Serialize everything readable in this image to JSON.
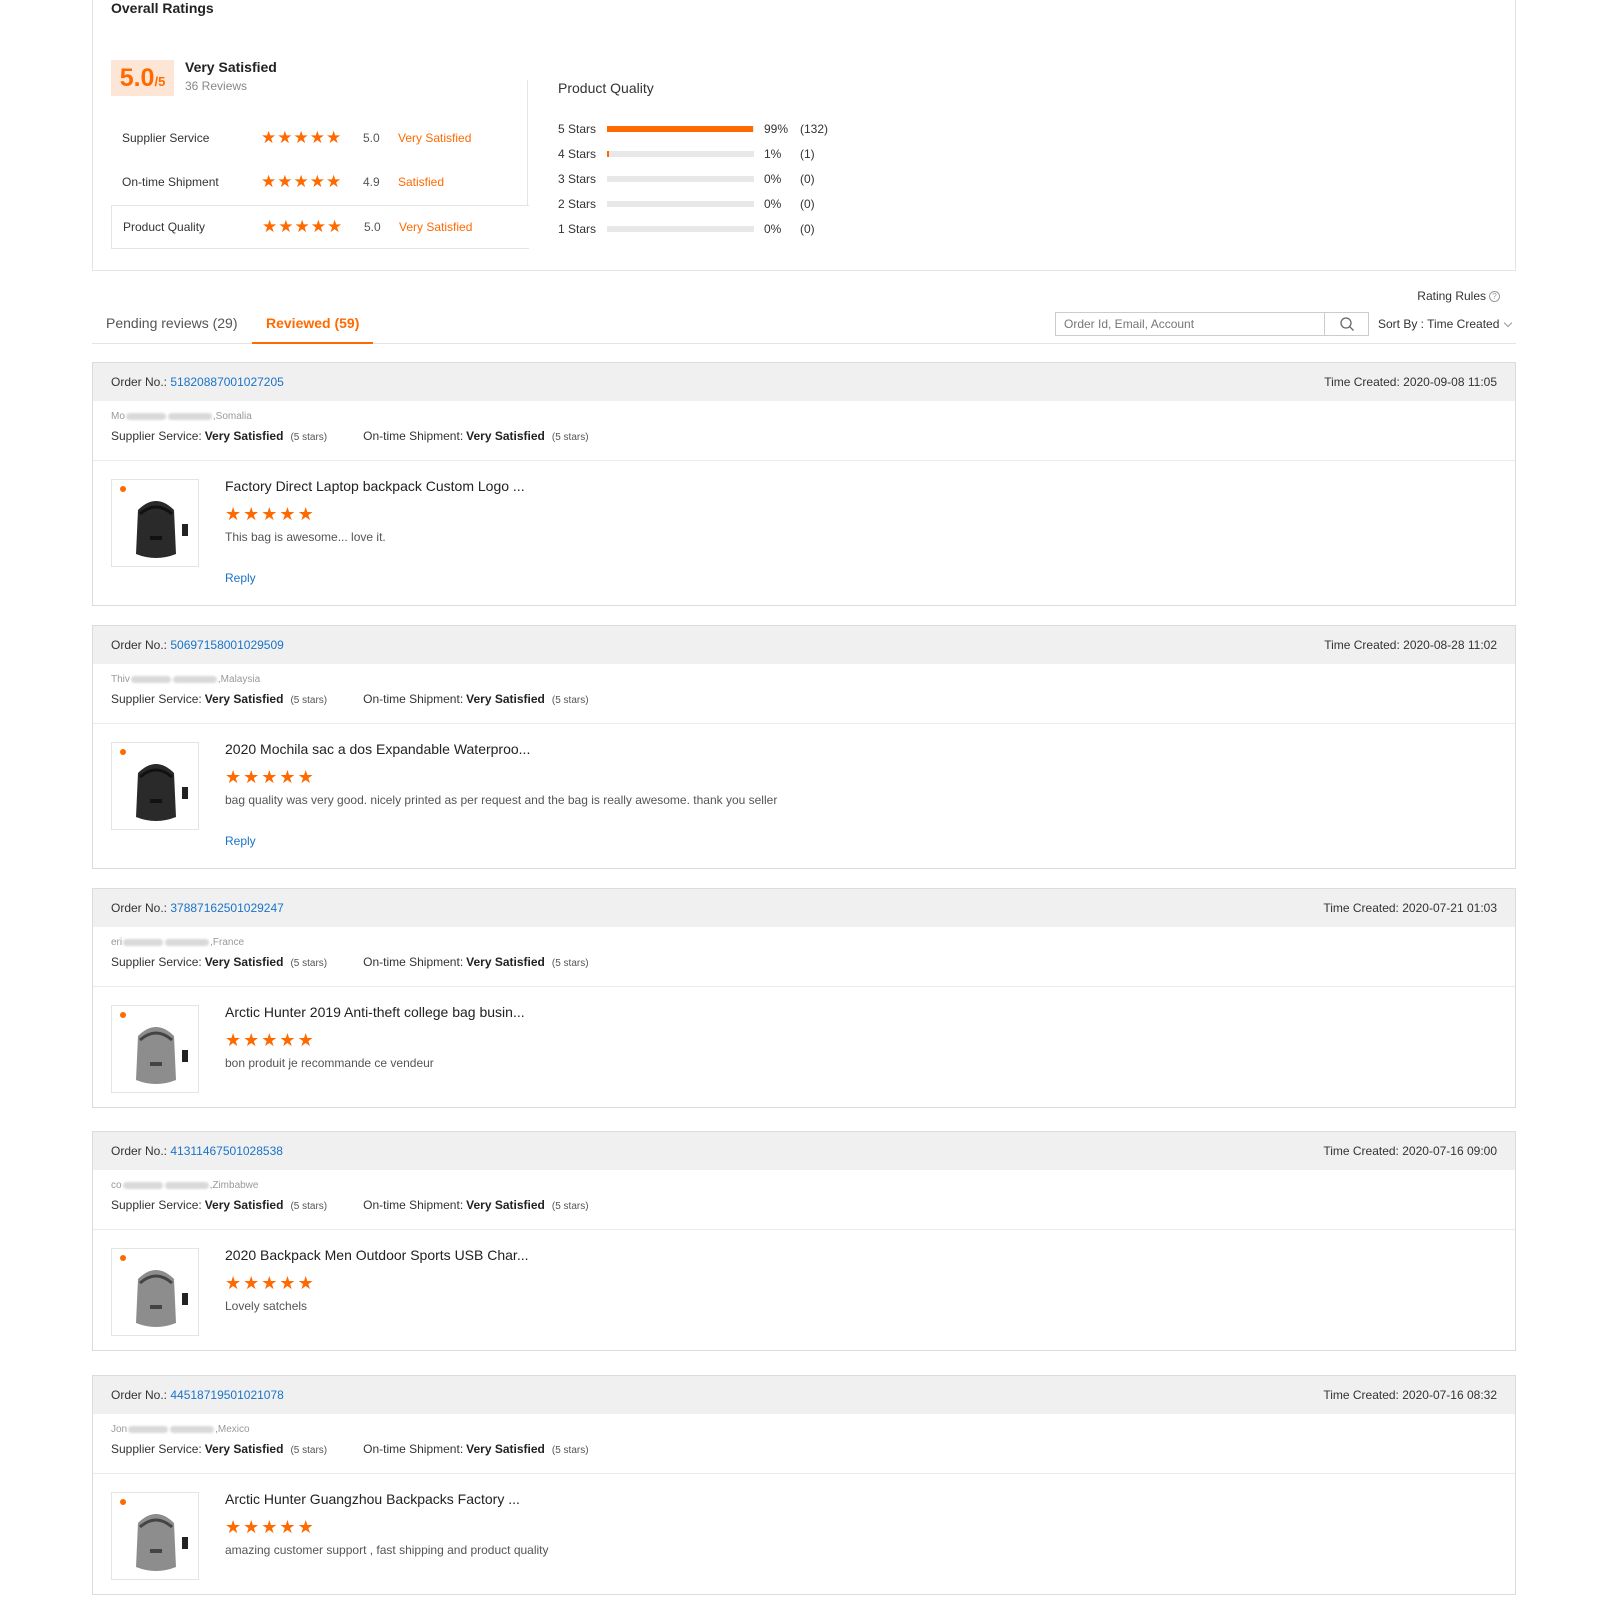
{
  "overall": {
    "title": "Overall Ratings",
    "score": "5.0",
    "score_suffix": "/5",
    "score_label": "Very Satisfied",
    "review_count": "36 Reviews",
    "metrics": [
      {
        "name": "Supplier Service",
        "stars": 5,
        "value": "5.0",
        "label": "Very Satisfied"
      },
      {
        "name": "On-time Shipment",
        "stars": 5,
        "value": "4.9",
        "label": "Satisfied"
      },
      {
        "name": "Product Quality",
        "stars": 5,
        "value": "5.0",
        "label": "Very Satisfied"
      }
    ],
    "distribution_title": "Product Quality",
    "distribution": [
      {
        "label": "5 Stars",
        "fraction": 0.99,
        "pct": "99%",
        "count": "(132)"
      },
      {
        "label": "4 Stars",
        "fraction": 0.01,
        "pct": "1%",
        "count": "(1)"
      },
      {
        "label": "3 Stars",
        "fraction": 0,
        "pct": "0%",
        "count": "(0)"
      },
      {
        "label": "2 Stars",
        "fraction": 0,
        "pct": "0%",
        "count": "(0)"
      },
      {
        "label": "1 Stars",
        "fraction": 0,
        "pct": "0%",
        "count": "(0)"
      }
    ]
  },
  "toolbar": {
    "rating_rules": "Rating Rules",
    "tab_pending": "Pending reviews (29)",
    "tab_reviewed": "Reviewed (59)",
    "search_placeholder": "Order Id, Email, Account",
    "sort_label": "Sort By : Time Created"
  },
  "labels": {
    "order_no": "Order No.:",
    "time_created": "Time Created:",
    "supplier_service": "Supplier Service:",
    "ontime_shipment": "On-time Shipment:",
    "reply": "Reply"
  },
  "reviews": [
    {
      "order_no": "51820887001027205",
      "time": "2020-09-08 11:05",
      "buyer_prefix": "Mo",
      "buyer_country": ",Somalia",
      "supplier_rating": "Very Satisfied",
      "supplier_stars": "(5 stars)",
      "shipment_rating": "Very Satisfied",
      "shipment_stars": "(5 stars)",
      "product_title": "Factory Direct Laptop backpack Custom Logo ...",
      "stars": 5,
      "text": "This bag is awesome... love it.",
      "has_reply": true,
      "thumb_icon": "backpack-black-icon"
    },
    {
      "order_no": "50697158001029509",
      "time": "2020-08-28 11:02",
      "buyer_prefix": "Thiv",
      "buyer_country": ",Malaysia",
      "supplier_rating": "Very Satisfied",
      "supplier_stars": "(5 stars)",
      "shipment_rating": "Very Satisfied",
      "shipment_stars": "(5 stars)",
      "product_title": "2020 Mochila sac a dos Expandable Waterproo...",
      "stars": 5,
      "text": "bag quality was very good. nicely printed as per request and the bag is really awesome. thank you seller",
      "has_reply": true,
      "thumb_icon": "backpack-black-icon"
    },
    {
      "order_no": "37887162501029247",
      "time": "2020-07-21 01:03",
      "buyer_prefix": "eri",
      "buyer_country": ",France",
      "supplier_rating": "Very Satisfied",
      "supplier_stars": "(5 stars)",
      "shipment_rating": "Very Satisfied",
      "shipment_stars": "(5 stars)",
      "product_title": "Arctic Hunter 2019 Anti-theft college bag busin...",
      "stars": 5,
      "text": "bon produit je recommande ce vendeur",
      "has_reply": false,
      "thumb_icon": "backpack-gray-icon"
    },
    {
      "order_no": "41311467501028538",
      "time": "2020-07-16 09:00",
      "buyer_prefix": "co",
      "buyer_country": ",Zimbabwe",
      "supplier_rating": "Very Satisfied",
      "supplier_stars": "(5 stars)",
      "shipment_rating": "Very Satisfied",
      "shipment_stars": "(5 stars)",
      "product_title": "2020 Backpack Men Outdoor Sports USB Char...",
      "stars": 5,
      "text": "Lovely satchels",
      "has_reply": false,
      "thumb_icon": "backpack-gray-icon"
    },
    {
      "order_no": "44518719501021078",
      "time": "2020-07-16 08:32",
      "buyer_prefix": "Jon",
      "buyer_country": ",Mexico",
      "supplier_rating": "Very Satisfied",
      "supplier_stars": "(5 stars)",
      "shipment_rating": "Very Satisfied",
      "shipment_stars": "(5 stars)",
      "product_title": "Arctic Hunter Guangzhou Backpacks Factory ...",
      "stars": 5,
      "text": "amazing customer support , fast shipping and product quality",
      "has_reply": false,
      "thumb_icon": "backpack-gray-icon"
    }
  ],
  "colors": {
    "accent": "#ff6a00",
    "link": "#1a73c8"
  }
}
